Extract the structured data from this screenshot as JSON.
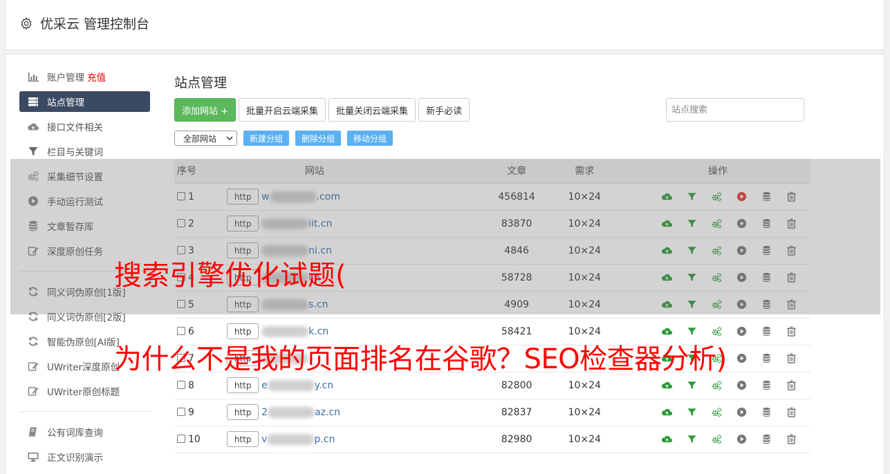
{
  "app": {
    "title": "优采云 管理控制台"
  },
  "sidebar": {
    "groups": [
      [
        {
          "label": "账户管理",
          "badge": "充值",
          "icon": "bar-chart-icon"
        },
        {
          "label": "站点管理",
          "icon": "server-icon",
          "active": true
        },
        {
          "label": "接口文件相关",
          "icon": "cloud-upload-icon"
        },
        {
          "label": "栏目与关键词",
          "icon": "filter-icon"
        },
        {
          "label": "采集细节设置",
          "icon": "gears-icon"
        },
        {
          "label": "手动运行测试",
          "icon": "play-circle-icon"
        },
        {
          "label": "文章暂存库",
          "icon": "database-icon"
        },
        {
          "label": "深度原创任务",
          "icon": "edit-icon"
        }
      ],
      [
        {
          "label": "同义词伪原创[1版]",
          "icon": "refresh-icon"
        },
        {
          "label": "同义词伪原创[2版]",
          "icon": "refresh-icon"
        },
        {
          "label": "智能伪原创[AI版]",
          "icon": "refresh-icon"
        },
        {
          "label": "UWriter深度原创",
          "icon": "edit-icon"
        },
        {
          "label": "UWriter原创标题",
          "icon": "edit-icon"
        }
      ],
      [
        {
          "label": "公有词库查询",
          "icon": "book-icon"
        },
        {
          "label": "正文识别演示",
          "icon": "desktop-icon"
        }
      ]
    ]
  },
  "main": {
    "title": "站点管理",
    "buttons": {
      "add_site": "添加网站 +",
      "batch_open": "批量开启云端采集",
      "batch_close": "批量关闭云端采集",
      "guide": "新手必读"
    },
    "search_placeholder": "站点搜索",
    "group_select": "全部网站",
    "group_buttons": {
      "new": "新建分组",
      "delete": "删除分组",
      "move": "移动分组"
    },
    "table": {
      "headers": {
        "no": "序号",
        "site": "网站",
        "articles": "文章",
        "demand": "需求",
        "ops": "操作"
      },
      "http_label": "http",
      "rows": [
        {
          "no": "1",
          "prefix": "w",
          "suffix": ".com",
          "articles": "456814",
          "demand": "10×24"
        },
        {
          "no": "2",
          "prefix": "",
          "suffix": "iit.cn",
          "articles": "83870",
          "demand": "10×24"
        },
        {
          "no": "3",
          "prefix": "",
          "suffix": "ni.cn",
          "articles": "4846",
          "demand": "10×24"
        },
        {
          "no": "4",
          "prefix": "",
          "suffix": "cn",
          "articles": "58728",
          "demand": "10×24"
        },
        {
          "no": "5",
          "prefix": "",
          "suffix": "s.cn",
          "articles": "4909",
          "demand": "10×24"
        },
        {
          "no": "6",
          "prefix": "",
          "suffix": "k.cn",
          "articles": "58421",
          "demand": "10×24"
        },
        {
          "no": "7",
          "prefix": "",
          "suffix": "",
          "articles": "",
          "demand": ""
        },
        {
          "no": "8",
          "prefix": "e",
          "suffix": "y.cn",
          "articles": "82800",
          "demand": "10×24"
        },
        {
          "no": "9",
          "prefix": "2",
          "suffix": "az.cn",
          "articles": "82837",
          "demand": "10×24"
        },
        {
          "no": "10",
          "prefix": "v",
          "suffix": "p.cn",
          "articles": "82980",
          "demand": "10×24"
        }
      ]
    }
  },
  "overlay": {
    "line1": "搜索引擎优化试题(",
    "line2": "为什么不是我的页面排名在谷歌？SEO检查器分析)"
  },
  "colors": {
    "sidebar_active": "#3b4a63",
    "primary_green": "#5cb85c",
    "link_blue": "#3a6ea5",
    "overlay_red": "#ff0000",
    "run_red": "#e53935",
    "op_green": "#2e9b3a"
  }
}
